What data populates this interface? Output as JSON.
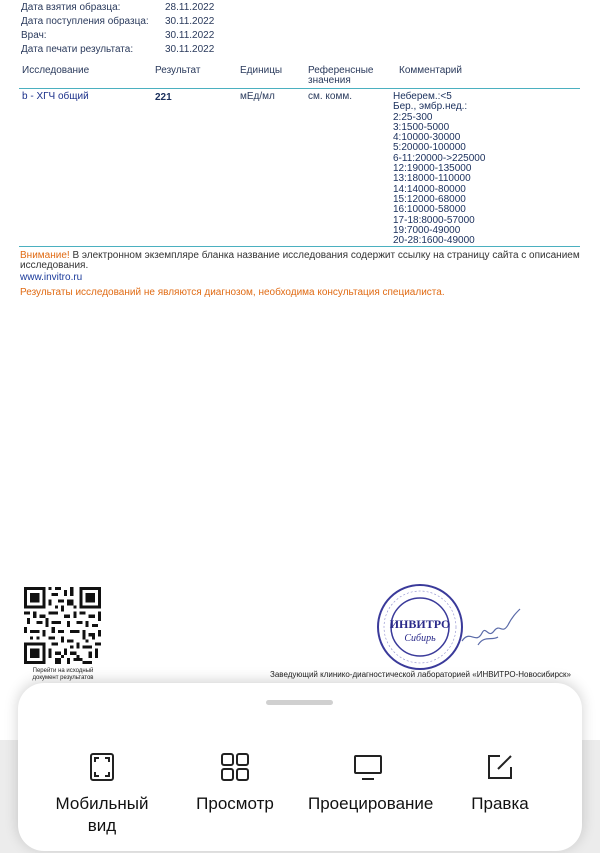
{
  "meta": [
    {
      "label": "Дата взятия образца:",
      "value": "28.11.2022"
    },
    {
      "label": "Дата поступления образца:",
      "value": "30.11.2022"
    },
    {
      "label": "Врач:",
      "value": "30.11.2022"
    },
    {
      "label": "Дата печати результата:",
      "value": "30.11.2022"
    }
  ],
  "table": {
    "headers": {
      "test": "Исследование",
      "result": "Результат",
      "units": "Единицы",
      "ref_line1": "Референсные",
      "ref_line2": "значения",
      "comment": "Комментарий"
    },
    "row": {
      "test": "b - ХГЧ общий",
      "result": "221",
      "units": "мЕд/мл",
      "ref": "см. комм.",
      "comment_lines": [
        "Неберем.:<5",
        "Бер., эмбр.нед.:",
        "2:25-300",
        "3:1500-5000",
        "4:10000-30000",
        "5:20000-100000",
        "6-11:20000->225000",
        "12:19000-135000",
        "13:18000-110000",
        "14:14000-80000",
        "15:12000-68000",
        "16:10000-58000",
        "17-18:8000-57000",
        "19:7000-49000",
        "20-28:1600-49000"
      ]
    }
  },
  "notice": {
    "attention": "Внимание!",
    "text": " В электронном экземпляре бланка название исследования содержит ссылку на страницу сайта с описанием исследования.",
    "link": "www.invitro.ru",
    "disclaimer": "Результаты исследований не являются диагнозом, необходима консультация специалиста."
  },
  "qr_caption": "Перейти на исходный документ результатов",
  "stamp": {
    "brand": "ИНВИТРО",
    "region": "Сибирь"
  },
  "signer": "Заведующий клинико-диагностической лабораторией «ИНВИТРО-Новосибирск»",
  "bottom_sheet": {
    "actions": [
      {
        "icon": "mobile-view-icon",
        "label": "Мобильный вид"
      },
      {
        "icon": "preview-grid-icon",
        "label": "Просмотр"
      },
      {
        "icon": "monitor-icon",
        "label": "Проецирование"
      },
      {
        "icon": "edit-icon",
        "label": "Правка"
      }
    ]
  },
  "colors": {
    "accent_line": "#4bb0c0",
    "warning": "#e06b14",
    "link": "#1a3a9a",
    "stamp": "#3a3a9a"
  }
}
